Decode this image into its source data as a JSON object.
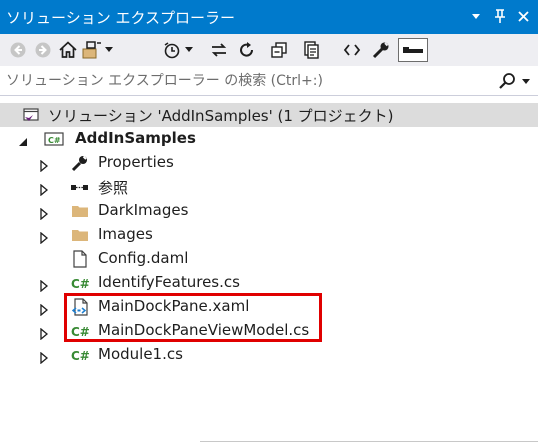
{
  "window": {
    "title": "ソリューション エクスプローラー",
    "dropdown_glyph": "▾",
    "pin_glyph": "⊥",
    "close_glyph": "✕"
  },
  "toolbar": {
    "items": [
      "back-icon",
      "forward-icon",
      "home-icon",
      "switch-views-icon",
      "pending-changes-icon",
      "sync-icon",
      "refresh-icon",
      "collapse-all-icon",
      "show-all-files-icon",
      "view-code-icon",
      "properties-icon",
      "preview-icon"
    ]
  },
  "search": {
    "placeholder": "ソリューション エクスプローラー の検索 (Ctrl+:)"
  },
  "tree": {
    "solution_label": "ソリューション 'AddInSamples' (1 プロジェクト)",
    "project_label": "AddInSamples",
    "items": [
      {
        "label": "Properties",
        "icon": "wrench-icon"
      },
      {
        "label": "参照",
        "icon": "references-icon"
      },
      {
        "label": "DarkImages",
        "icon": "folder-icon"
      },
      {
        "label": "Images",
        "icon": "folder-icon"
      },
      {
        "label": "Config.daml",
        "icon": "file-icon"
      },
      {
        "label": "IdentifyFeatures.cs",
        "icon": "csharp-file-icon"
      },
      {
        "label": "MainDockPane.xaml",
        "icon": "xaml-file-icon"
      },
      {
        "label": "MainDockPaneViewModel.cs",
        "icon": "csharp-file-icon"
      },
      {
        "label": "Module1.cs",
        "icon": "csharp-file-icon"
      }
    ]
  },
  "colors": {
    "titlebar": "#007acc",
    "toolbar": "#eeeef2",
    "selection": "#dcdcdc",
    "highlight_box": "#e00000",
    "csharp": "#388a34",
    "folder": "#dcb67a"
  }
}
